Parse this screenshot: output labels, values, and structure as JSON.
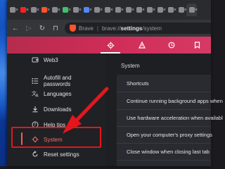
{
  "tabs": [
    {
      "icon": "page-icon"
    },
    {
      "icon": "youtube-icon"
    },
    {
      "icon": "page-icon"
    },
    {
      "icon": "brave-icon"
    },
    {
      "icon": "page-icon"
    },
    {
      "icon": "green-icon"
    },
    {
      "icon": "page-icon"
    },
    {
      "icon": "blue-icon"
    },
    {
      "icon": "page-icon"
    },
    {
      "icon": "page-icon"
    },
    {
      "icon": "page-icon"
    },
    {
      "icon": "page-icon"
    },
    {
      "icon": "page-icon"
    },
    {
      "icon": "page-icon"
    },
    {
      "icon": "page-icon"
    },
    {
      "icon": "page-icon"
    },
    {
      "icon": "page-icon"
    },
    {
      "icon": "page-icon"
    }
  ],
  "tab_close_glyph": "×",
  "toolbar": {
    "back": "←",
    "forward": "▷",
    "reload": "↻",
    "bookmark": "⊓",
    "browser_name": "Brave",
    "separator": "|",
    "url_prefix": "brave://",
    "url_bold": "settings",
    "url_suffix": "/system"
  },
  "header_icons": [
    "gear-icon",
    "shields-icon",
    "history-icon",
    "bookmark-icon"
  ],
  "sidebar": {
    "items": [
      {
        "label": "Web3",
        "icon": "wallet-icon"
      },
      {
        "label": "Autofill and passwords",
        "icon": "autofill-icon"
      },
      {
        "label": "Languages",
        "icon": "languages-icon"
      },
      {
        "label": "Downloads",
        "icon": "download-icon"
      },
      {
        "label": "Help tips",
        "icon": "help-icon"
      },
      {
        "label": "System",
        "icon": "system-icon"
      },
      {
        "label": "Reset settings",
        "icon": "reset-icon"
      }
    ],
    "selected": "System"
  },
  "main": {
    "section_title": "System",
    "rows": [
      "Shortcuts",
      "Continue running background apps when",
      "Use hardware acceleration when availabl",
      "Open your computer's proxy settings",
      "Close window when closing last tab"
    ]
  },
  "colors": {
    "accent": "#cf2d58",
    "selected_text": "#ff6b5a",
    "annotation_red": "#e4161c"
  }
}
